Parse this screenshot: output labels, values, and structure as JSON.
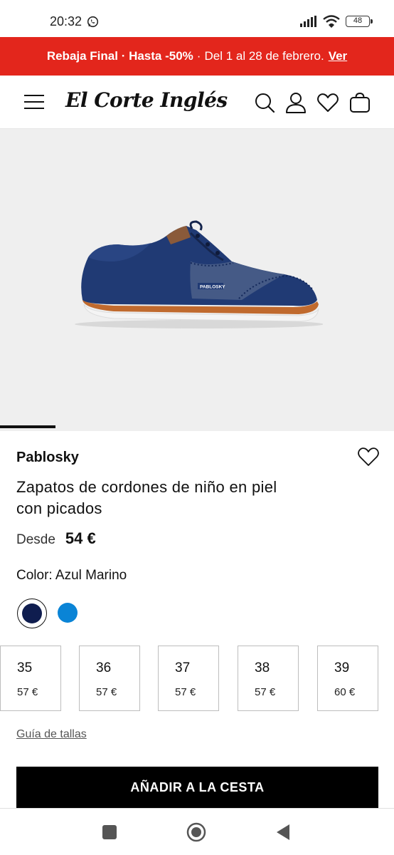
{
  "status": {
    "time": "20:32",
    "battery": "48"
  },
  "promo": {
    "bold": "Rebaja Final · Hasta -50%",
    "separator": "·",
    "text": "Del 1 al 28 de febrero.",
    "link": "Ver",
    "background": "#e3261c"
  },
  "header": {
    "logo": "El Corte Inglés",
    "icons": [
      "menu-icon",
      "search-icon",
      "user-icon",
      "heart-icon",
      "bag-icon"
    ]
  },
  "gallery": {
    "progress_fraction": 0.14,
    "shoe_label": "PABLOSKY"
  },
  "product": {
    "brand": "Pablosky",
    "title_line1": "Zapatos de cordones de niño en piel",
    "title_line2": "con picados",
    "price_prefix": "Desde",
    "price": "54 €",
    "color_label": "Color:",
    "color_value": "Azul Marino",
    "swatches": [
      {
        "color": "#0f1d4f",
        "selected": true
      },
      {
        "color": "#0a84d6",
        "selected": false
      }
    ],
    "sizes": [
      {
        "size": "35",
        "price": "57 €"
      },
      {
        "size": "36",
        "price": "57 €"
      },
      {
        "size": "37",
        "price": "57 €"
      },
      {
        "size": "38",
        "price": "57 €"
      },
      {
        "size": "39",
        "price": "60 €"
      }
    ],
    "size_guide": "Guía de tallas",
    "add_to_cart": "AÑADIR A LA CESTA"
  }
}
